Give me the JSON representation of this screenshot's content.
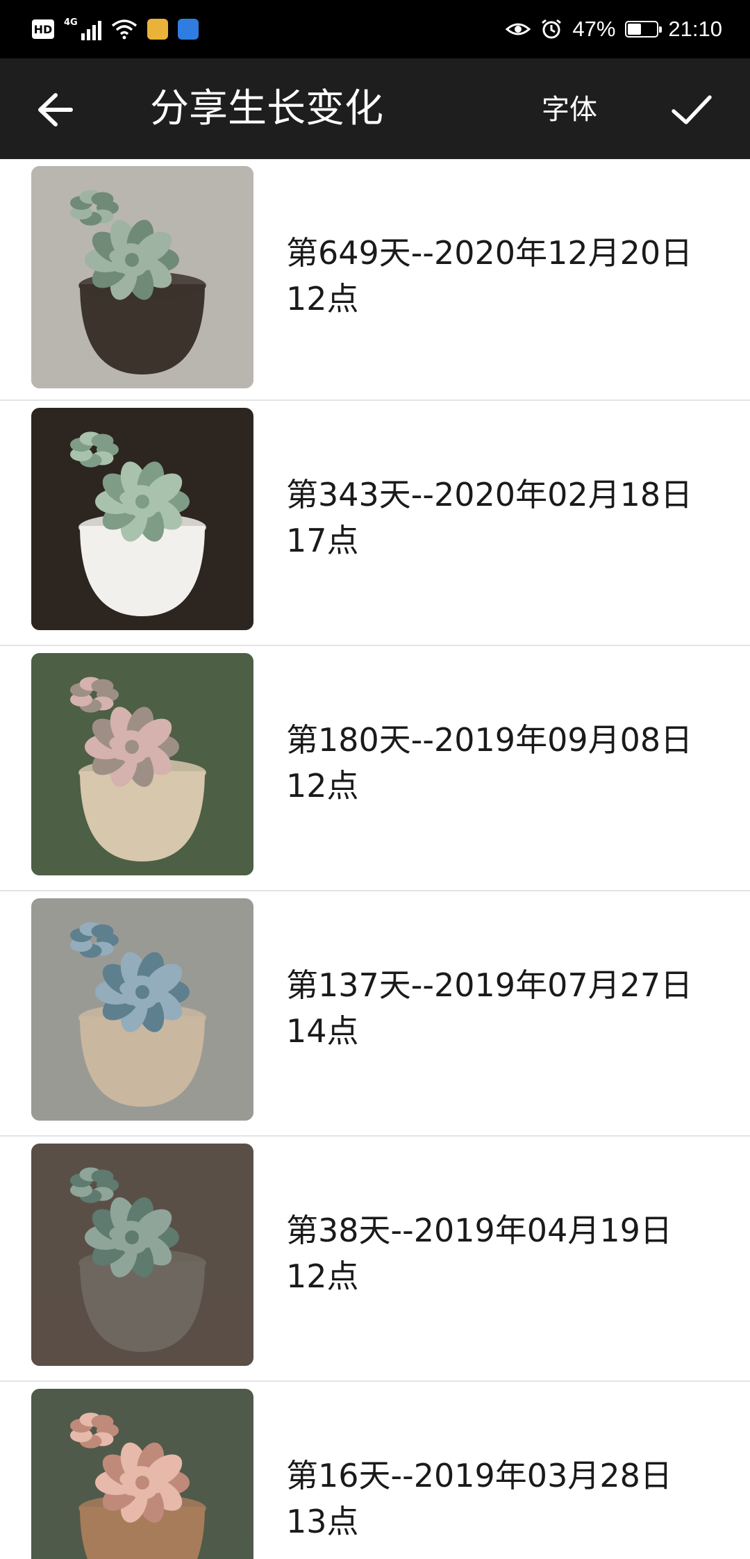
{
  "status_bar": {
    "hd_label": "HD",
    "network_label": "4G",
    "battery_percent": "47%",
    "battery_level": 0.47,
    "time": "21:10"
  },
  "title_bar": {
    "title": "分享生长变化",
    "font_label": "字体",
    "back_icon": "arrow-left-icon",
    "confirm_icon": "check-icon"
  },
  "entries": [
    {
      "line1": "第649天--2020年12月20日",
      "line2": "12点",
      "photo": "succulent-in-patterned-pot",
      "colors": {
        "bg": "#b9b6b0",
        "pot": "#3b332c",
        "leaf": "#9fb3a2",
        "leaf_dark": "#6f8a76"
      }
    },
    {
      "line1": "第343天--2020年02月18日",
      "line2": "17点",
      "photo": "succulent-in-white-square-pot",
      "colors": {
        "bg": "#2d2520",
        "pot": "#f2f0ec",
        "leaf": "#a9c2ad",
        "leaf_dark": "#7f9c86"
      }
    },
    {
      "line1": "第180天--2019年09月08日",
      "line2": "12点",
      "photo": "succulent-in-ceramic-pot",
      "colors": {
        "bg": "#4d5f45",
        "pot": "#d7c7ad",
        "leaf": "#d5b2ad",
        "leaf_dark": "#9e8f86"
      }
    },
    {
      "line1": "第137天--2019年07月27日",
      "line2": "14点",
      "photo": "succulent-in-terracotta-pot",
      "colors": {
        "bg": "#9a9a95",
        "pot": "#c9b7a0",
        "leaf": "#93adbd",
        "leaf_dark": "#5e7f8e"
      }
    },
    {
      "line1": "第38天--2019年04月19日",
      "line2": "12点",
      "photo": "succulent-cutting-in-hand",
      "colors": {
        "bg": "#5a4f47",
        "pot": "#6e675f",
        "leaf": "#8fa59a",
        "leaf_dark": "#5f7a6f"
      }
    },
    {
      "line1": "第16天--2019年03月28日",
      "line2": "13点",
      "photo": "pink-succulent-rosette",
      "colors": {
        "bg": "#4f5a4a",
        "pot": "#a77c5b",
        "leaf": "#e7b9aa",
        "leaf_dark": "#c08a7a"
      }
    }
  ]
}
